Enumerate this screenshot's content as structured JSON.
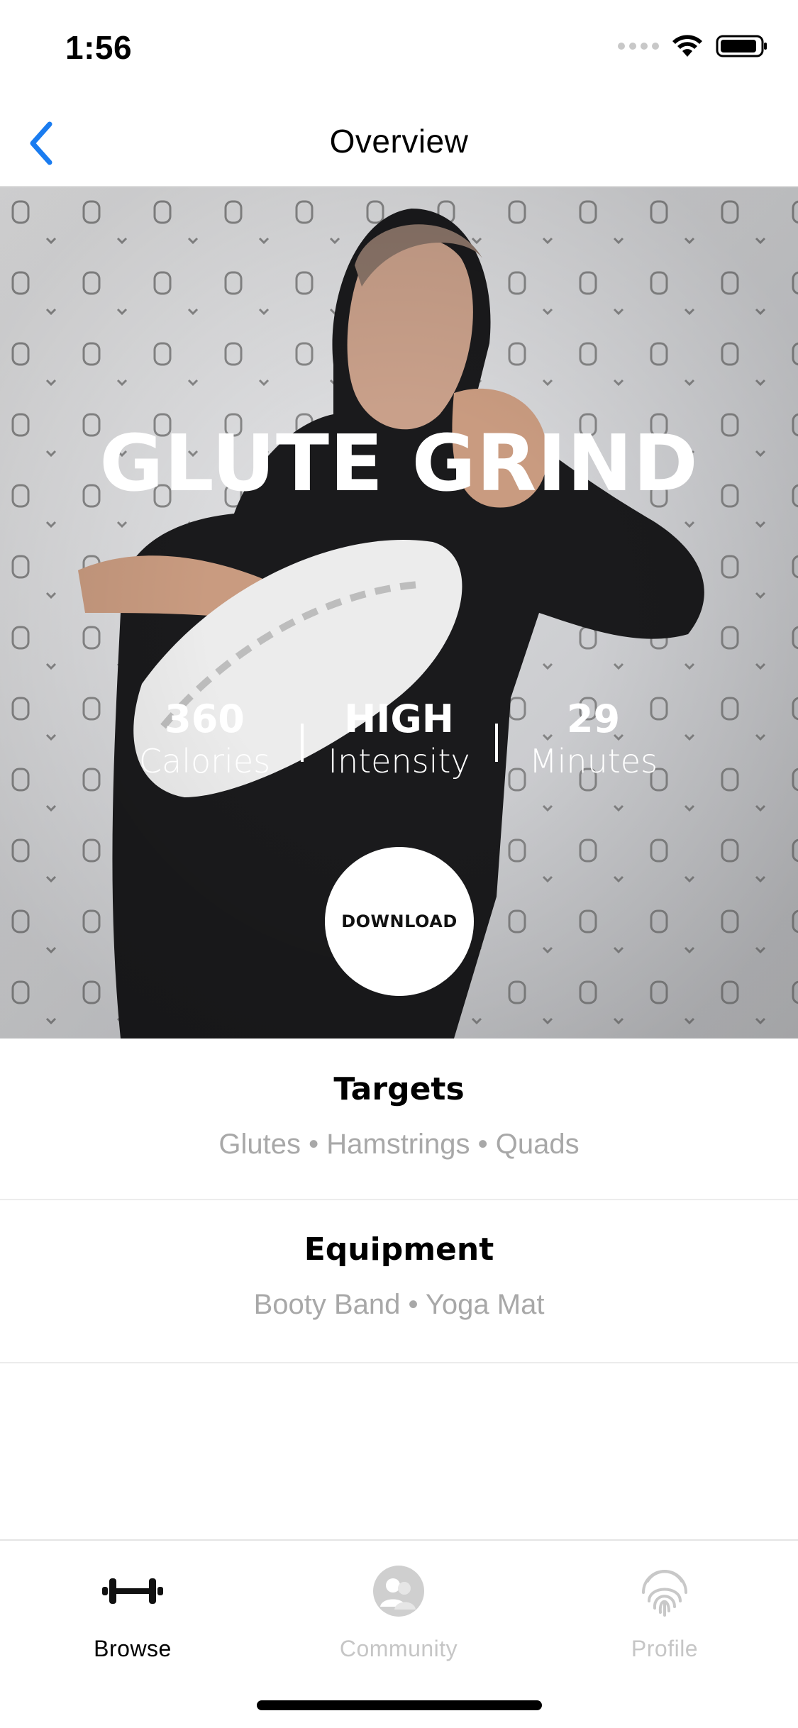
{
  "status_bar": {
    "time": "1:56"
  },
  "nav": {
    "title": "Overview",
    "accent_color": "#1a7cf0"
  },
  "hero": {
    "title": "GLUTE GRIND",
    "stats": [
      {
        "value": "360",
        "label": "Calories"
      },
      {
        "value": "HIGH",
        "label": "Intensity"
      },
      {
        "value": "29",
        "label": "Minutes"
      }
    ],
    "download_label": "DOWNLOAD"
  },
  "targets": {
    "heading": "Targets",
    "items": "Glutes • Hamstrings • Quads"
  },
  "equipment": {
    "heading": "Equipment",
    "items": "Booty Band • Yoga Mat"
  },
  "tabs": [
    {
      "label": "Browse",
      "icon": "dumbbell-icon",
      "active": true
    },
    {
      "label": "Community",
      "icon": "community-icon",
      "active": false
    },
    {
      "label": "Profile",
      "icon": "fingerprint-icon",
      "active": false
    }
  ]
}
